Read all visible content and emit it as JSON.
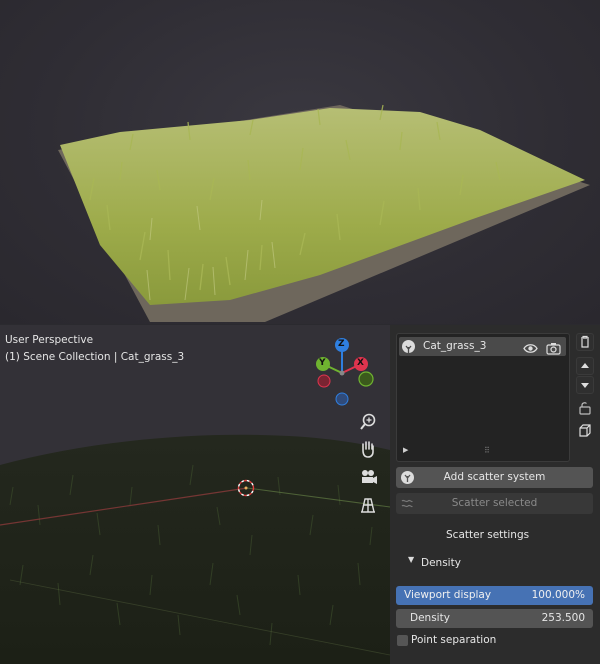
{
  "viewport": {
    "mode_label": "User Perspective",
    "collection_label": "(1) Scene Collection | Cat_grass_3",
    "gizmo": {
      "z": "Z",
      "y": "Y",
      "x": "X"
    }
  },
  "scatter_list": {
    "items": [
      {
        "name": "Cat_grass_3"
      }
    ]
  },
  "buttons": {
    "add_scatter": "Add scatter system",
    "scatter_selected": "Scatter selected"
  },
  "settings": {
    "title": "Scatter settings",
    "density_section": "Density",
    "viewport_display": {
      "label": "Viewport display",
      "value": "100.000%"
    },
    "density": {
      "label": "Density",
      "value": "253.500"
    },
    "point_separation": {
      "label": "Point separation",
      "checked": false
    }
  },
  "colors": {
    "accent": "#4672b4",
    "gizmo_x": "#e0344e",
    "gizmo_y": "#6fb330",
    "gizmo_z": "#2f7fe0",
    "grass": "#a6b45a"
  },
  "icons": [
    "eye-icon",
    "camera-icon",
    "trash-icon",
    "arrow-up-icon",
    "arrow-down-icon",
    "lock-icon",
    "cube-icon",
    "zoom-icon",
    "hand-icon",
    "camera-view-icon",
    "grid-icon",
    "grass-icon",
    "triangle-down-icon",
    "play-icon"
  ]
}
